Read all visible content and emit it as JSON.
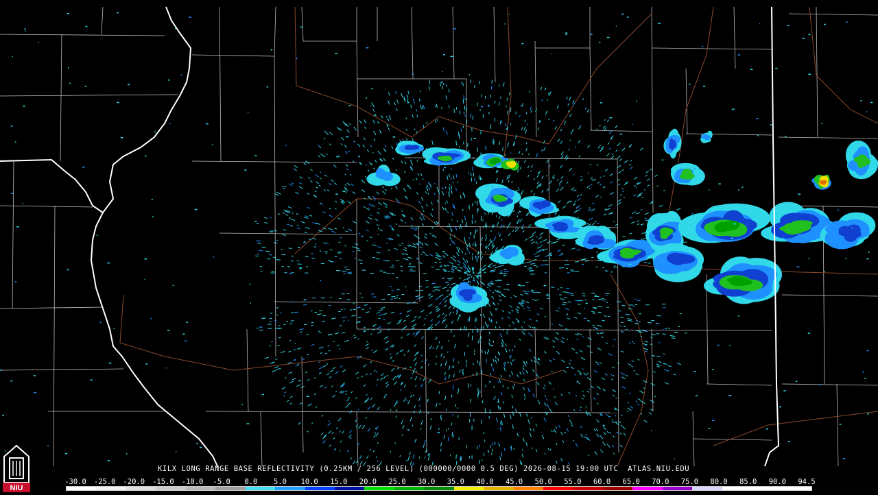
{
  "caption": "KILX LONG RANGE BASE REFLECTIVITY (0.25KM / 256 LEVEL) (000000/0000 0.5 DEG) 2026-08-15 19:00 UTC  ATLAS.NIU.EDU",
  "logo": {
    "text": "NIU",
    "icon": "niu-tower-logo-icon",
    "color": "#c8102e"
  },
  "scale": {
    "labels": [
      "-30.0",
      "-25.0",
      "-20.0",
      "-15.0",
      "-10.0",
      "-5.0",
      "0.0",
      "5.0",
      "10.0",
      "15.0",
      "20.0",
      "25.0",
      "30.0",
      "35.0",
      "40.0",
      "45.0",
      "50.0",
      "55.0",
      "60.0",
      "65.0",
      "70.0",
      "75.0",
      "80.0",
      "85.0",
      "90.0",
      "94.5"
    ],
    "colors": [
      "#ffffff",
      "#f2f2f2",
      "#e0e0e0",
      "#cccccc",
      "#b8b8b8",
      "#a0a0a0",
      "#40e0f0",
      "#1f9fff",
      "#0040ff",
      "#0010a0",
      "#00e000",
      "#00b400",
      "#008c00",
      "#f0f000",
      "#e6b400",
      "#ff8000",
      "#ff0000",
      "#c80000",
      "#a00000",
      "#ff00ff",
      "#9600c8",
      "#d8d8ff",
      "#ffffff",
      "#ffffff",
      "#ffffff"
    ]
  },
  "map": {
    "state_border_color": "#ffffff",
    "county_line_color": "#c8c8c8",
    "highway_color": "#8b4513",
    "echo_colors": [
      "#30d8e8",
      "#1e90ff",
      "#1040d0",
      "#20c020",
      "#00a000",
      "#f0e000",
      "#e07000"
    ]
  }
}
